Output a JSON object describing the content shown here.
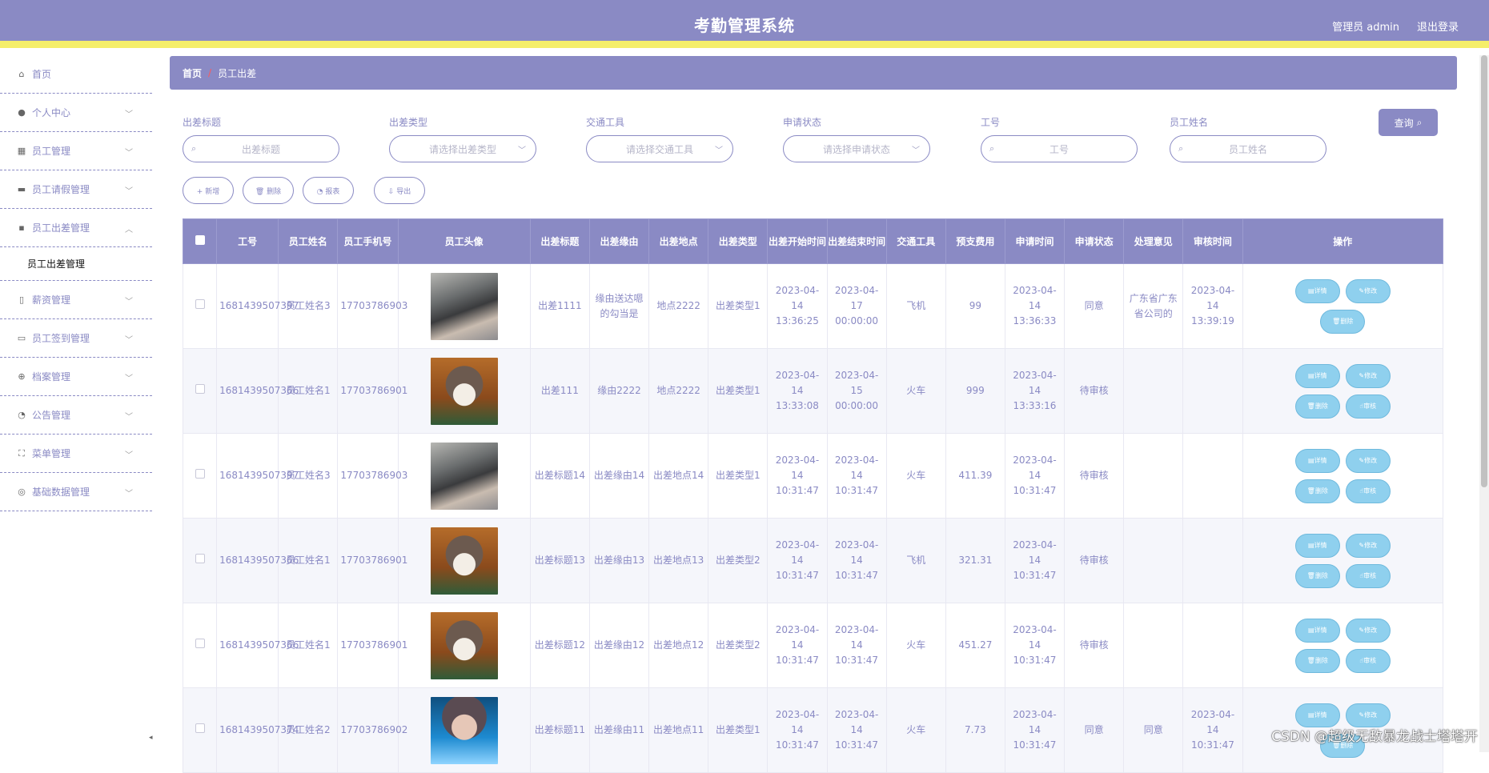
{
  "header": {
    "title": "考勤管理系统",
    "user": "管理员 admin",
    "logout": "退出登录"
  },
  "sidebar": {
    "items": [
      {
        "label": "首页",
        "icon": "home-icon",
        "glyph": "⌂"
      },
      {
        "label": "个人中心",
        "icon": "user-icon",
        "glyph": "●"
      },
      {
        "label": "员工管理",
        "icon": "grid-icon",
        "glyph": "▦"
      },
      {
        "label": "员工请假管理",
        "icon": "tag-icon",
        "glyph": "▬"
      },
      {
        "label": "员工出差管理",
        "icon": "apps-icon",
        "glyph": "▪"
      },
      {
        "label": "薪资管理",
        "icon": "mic-icon",
        "glyph": "▯"
      },
      {
        "label": "员工签到管理",
        "icon": "chat-icon",
        "glyph": "▭"
      },
      {
        "label": "档案管理",
        "icon": "target-icon",
        "glyph": "⊕"
      },
      {
        "label": "公告管理",
        "icon": "dashboard-icon",
        "glyph": "◔"
      },
      {
        "label": "菜单管理",
        "icon": "fullscreen-icon",
        "glyph": "⛶"
      },
      {
        "label": "基础数据管理",
        "icon": "compass-icon",
        "glyph": "◎"
      }
    ],
    "submenu": "员工出差管理"
  },
  "breadcrumb": {
    "home": "首页",
    "sep": "/",
    "current": "员工出差"
  },
  "filters": [
    {
      "label": "出差标题",
      "placeholder": "出差标题",
      "type": "input"
    },
    {
      "label": "出差类型",
      "placeholder": "请选择出差类型",
      "type": "select"
    },
    {
      "label": "交通工具",
      "placeholder": "请选择交通工具",
      "type": "select"
    },
    {
      "label": "申请状态",
      "placeholder": "请选择申请状态",
      "type": "select"
    },
    {
      "label": "工号",
      "placeholder": "工号",
      "type": "input"
    },
    {
      "label": "员工姓名",
      "placeholder": "员工姓名",
      "type": "input"
    }
  ],
  "query_label": "查询",
  "actions": [
    "+ 新增",
    "🗑 删除",
    "◔ 报表",
    "⇩ 导出"
  ],
  "table": {
    "headers": [
      "工号",
      "员工姓名",
      "员工手机号",
      "员工头像",
      "出差标题",
      "出差缘由",
      "出差地点",
      "出差类型",
      "出差开始时间",
      "出差结束时间",
      "交通工具",
      "预支费用",
      "申请时间",
      "申请状态",
      "处理意见",
      "审核时间",
      "操作"
    ],
    "rows": [
      {
        "id": "1681439507397",
        "name": "员工姓名3",
        "phone": "17703786903",
        "avatar": "girl",
        "title": "出差1111",
        "reason": "缘由送达嗯的勾当是",
        "place": "地点2222",
        "type": "出差类型1",
        "start": "2023-04-14 13:36:25",
        "end": "2023-04-17 00:00:00",
        "transport": "飞机",
        "cost": "99",
        "apply_time": "2023-04-14 13:36:33",
        "status": "同意",
        "opinion": "广东省广东省公司的",
        "audit_time": "2023-04-14 13:39:19",
        "audit_btn": false
      },
      {
        "id": "1681439507366",
        "name": "员工姓名1",
        "phone": "17703786901",
        "avatar": "cat",
        "title": "出差111",
        "reason": "缘由2222",
        "place": "地点2222",
        "type": "出差类型1",
        "start": "2023-04-14 13:33:08",
        "end": "2023-04-15 00:00:00",
        "transport": "火车",
        "cost": "999",
        "apply_time": "2023-04-14 13:33:16",
        "status": "待审核",
        "opinion": "",
        "audit_time": "",
        "audit_btn": true
      },
      {
        "id": "1681439507397",
        "name": "员工姓名3",
        "phone": "17703786903",
        "avatar": "girl",
        "title": "出差标题14",
        "reason": "出差缘由14",
        "place": "出差地点14",
        "type": "出差类型1",
        "start": "2023-04-14 10:31:47",
        "end": "2023-04-14 10:31:47",
        "transport": "火车",
        "cost": "411.39",
        "apply_time": "2023-04-14 10:31:47",
        "status": "待审核",
        "opinion": "",
        "audit_time": "",
        "audit_btn": true
      },
      {
        "id": "1681439507366",
        "name": "员工姓名1",
        "phone": "17703786901",
        "avatar": "cat",
        "title": "出差标题13",
        "reason": "出差缘由13",
        "place": "出差地点13",
        "type": "出差类型2",
        "start": "2023-04-14 10:31:47",
        "end": "2023-04-14 10:31:47",
        "transport": "飞机",
        "cost": "321.31",
        "apply_time": "2023-04-14 10:31:47",
        "status": "待审核",
        "opinion": "",
        "audit_time": "",
        "audit_btn": true
      },
      {
        "id": "1681439507366",
        "name": "员工姓名1",
        "phone": "17703786901",
        "avatar": "cat",
        "title": "出差标题12",
        "reason": "出差缘由12",
        "place": "出差地点12",
        "type": "出差类型2",
        "start": "2023-04-14 10:31:47",
        "end": "2023-04-14 10:31:47",
        "transport": "火车",
        "cost": "451.27",
        "apply_time": "2023-04-14 10:31:47",
        "status": "待审核",
        "opinion": "",
        "audit_time": "",
        "audit_btn": true
      },
      {
        "id": "1681439507374",
        "name": "员工姓名2",
        "phone": "17703786902",
        "avatar": "boy",
        "title": "出差标题11",
        "reason": "出差缘由11",
        "place": "出差地点11",
        "type": "出差类型1",
        "start": "2023-04-14 10:31:47",
        "end": "2023-04-14 10:31:47",
        "transport": "火车",
        "cost": "7.73",
        "apply_time": "2023-04-14 10:31:47",
        "status": "同意",
        "opinion": "同意",
        "audit_time": "2023-04-14 10:31:47",
        "audit_btn": false
      }
    ],
    "op_labels": {
      "detail": "详情",
      "edit": "修改",
      "delete": "删除",
      "audit": "审核"
    }
  },
  "watermark": "CSDN @超级无敌暴龙战士塔塔开"
}
